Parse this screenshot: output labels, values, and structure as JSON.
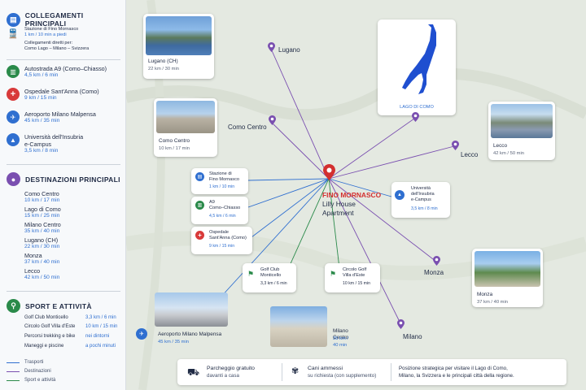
{
  "sidebar": {
    "transport": {
      "title": "COLLEGAMENTI PRINCIPALI",
      "station": {
        "name": "Stazione di Fino Mornasco",
        "detail": "1 km / 10 min a piedi",
        "direct_label": "Collegamenti diretti per:",
        "direct": "Como Lago – Milano – Svizzera"
      },
      "items": [
        {
          "name": "Autostrada A9 (Como–Chiasso)",
          "detail": "4,5 km / 6 min",
          "icon": "highway-icon",
          "color": "#2a8a4a"
        },
        {
          "name": "Ospedale Sant'Anna (Como)",
          "detail": "9 km / 15 min",
          "icon": "hospital-icon",
          "color": "#d83a3a"
        },
        {
          "name": "Aeroporto Milano Malpensa",
          "detail": "45 km / 35 min",
          "icon": "airplane-icon",
          "color": "#2f6fd0"
        },
        {
          "name": "Università dell'Insubria",
          "name2": "e-Campus",
          "detail": "3,5 km / 8 min",
          "icon": "graduation-icon",
          "color": "#2f6fd0"
        }
      ]
    },
    "destinations": {
      "title": "DESTINAZIONI PRINCIPALI",
      "items": [
        {
          "name": "Como Centro",
          "detail": "10 km / 17 min"
        },
        {
          "name": "Lago di Como",
          "detail": "15 km / 25 min"
        },
        {
          "name": "Milano Centro",
          "detail": "35 km / 40 min"
        },
        {
          "name": "Lugano (CH)",
          "detail": "22 km / 30 min"
        },
        {
          "name": "Monza",
          "detail": "37 km / 40 min"
        },
        {
          "name": "Lecco",
          "detail": "42 km / 50 min"
        }
      ]
    },
    "sport": {
      "title": "SPORT E ATTIVITÀ",
      "items": [
        {
          "name": "Golf Club Monticello",
          "detail": "3,3 km / 6 min"
        },
        {
          "name": "Circolo Golf Villa d'Este",
          "detail": "10 km / 15 min"
        },
        {
          "name": "Percorsi trekking e bike",
          "detail": "nei dintorni"
        },
        {
          "name": "Maneggi e piscine",
          "detail": "a pochi minuti"
        }
      ]
    },
    "legend": [
      "Trasporti",
      "Destinazioni",
      "Sport e attività"
    ]
  },
  "map": {
    "center": {
      "name": "FINO MORNASCO",
      "sub1": "Lilly House",
      "sub2": "Apartment"
    },
    "places": {
      "lugano": "Lugano",
      "como": "Como Centro",
      "lecco": "Lecco",
      "monza": "Monza",
      "milano": "Milano"
    },
    "lake_label": "LAGO DI COMO",
    "cards": {
      "lugano": {
        "name": "Lugano (CH)",
        "detail": "22 km / 30 min"
      },
      "como": {
        "name": "Como Centro",
        "detail": "10 km / 17 min"
      },
      "lecco": {
        "name": "Lecco",
        "detail": "42 km / 50 min"
      },
      "monza": {
        "name": "Monza",
        "detail": "37 km / 40 min"
      },
      "milano": {
        "name": "Milano Centro",
        "detail": "35 km / 40 min"
      },
      "malpensa": {
        "name": "Aeroporto Milano Malpensa",
        "detail": "45 km / 35 min"
      },
      "station": {
        "name1": "Stazione di",
        "name2": "Fino Mornasco",
        "detail": "1 km / 10 min"
      },
      "a9": {
        "name1": "A9",
        "name2": "Como–Chiasso",
        "detail": "4,5 km / 6 min"
      },
      "hospital": {
        "name1": "Ospedale",
        "name2": "Sant'Anna (Como)",
        "detail": "9 km / 15 min"
      },
      "uni": {
        "name1": "Università",
        "name2": "dell'Insubria",
        "name3": "e-Campus",
        "detail": "3,5 km / 8 min"
      },
      "golf1": {
        "name1": "Golf Club",
        "name2": "Monticello",
        "detail": "3,3 km / 6 min"
      },
      "golf2": {
        "name1": "Circolo Golf",
        "name2": "Villa d'Este",
        "detail": "10 km / 15 min"
      }
    }
  },
  "footer": {
    "parking": {
      "title": "Parcheggio gratuito",
      "detail": "davanti a casa"
    },
    "pets": {
      "title": "Cani ammessi",
      "detail": "su richiesta (con supplemento)"
    },
    "note1": "Posizione strategica per visitare il Lago di Como,",
    "note2": "Milano, la Svizzera e le principali città della regione."
  },
  "colors": {
    "transport": "#2f6fd0",
    "destinations": "#7a4fb0",
    "sport": "#2a8a4a",
    "center_pin": "#d32f2f"
  }
}
